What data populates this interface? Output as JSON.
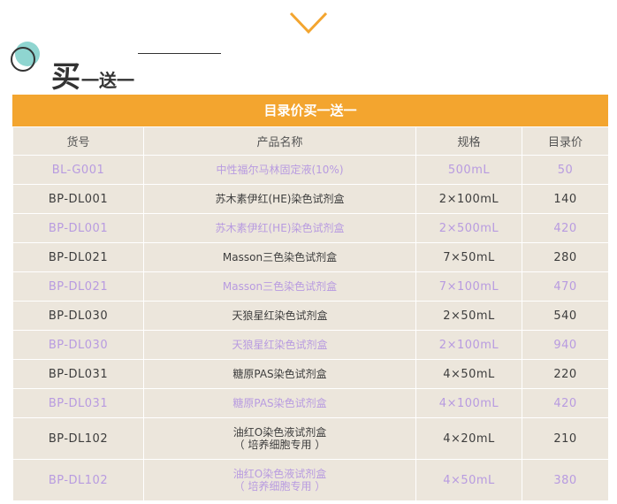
{
  "header": {
    "title_main": "买",
    "title_sub": "一送一"
  },
  "colors": {
    "accent_orange": "#f3a52f",
    "circle_teal": "#8fd5d0",
    "table_bg": "#ece6dc",
    "light_text": "#b89be0",
    "dark_text": "#3d3d3d"
  },
  "table": {
    "banner": "目录价买一送一",
    "columns": [
      "货号",
      "产品名称",
      "规格",
      "目录价"
    ],
    "rows": [
      {
        "code": "BL-G001",
        "name": "中性福尔马林固定液(10%)",
        "name2": "",
        "spec": "500mL",
        "price": "50"
      },
      {
        "code": "BP-DL001",
        "name": "苏木素伊红(HE)染色试剂盒",
        "name2": "",
        "spec": "2×100mL",
        "price": "140"
      },
      {
        "code": "BP-DL001",
        "name": "苏木素伊红(HE)染色试剂盒",
        "name2": "",
        "spec": "2×500mL",
        "price": "420"
      },
      {
        "code": "BP-DL021",
        "name": "Masson三色染色试剂盒",
        "name2": "",
        "spec": "7×50mL",
        "price": "280"
      },
      {
        "code": "BP-DL021",
        "name": "Masson三色染色试剂盒",
        "name2": "",
        "spec": "7×100mL",
        "price": "470"
      },
      {
        "code": "BP-DL030",
        "name": "天狼星红染色试剂盒",
        "name2": "",
        "spec": "2×50mL",
        "price": "540"
      },
      {
        "code": "BP-DL030",
        "name": "天狼星红染色试剂盒",
        "name2": "",
        "spec": "2×100mL",
        "price": "940"
      },
      {
        "code": "BP-DL031",
        "name": "糖原PAS染色试剂盒",
        "name2": "",
        "spec": "4×50mL",
        "price": "220"
      },
      {
        "code": "BP-DL031",
        "name": "糖原PAS染色试剂盒",
        "name2": "",
        "spec": "4×100mL",
        "price": "420"
      },
      {
        "code": "BP-DL102",
        "name": "油红O染色液试剂盒",
        "name2": "（ 培养细胞专用 ）",
        "spec": "4×20mL",
        "price": "210"
      },
      {
        "code": "BP-DL102",
        "name": "油红O染色液试剂盒",
        "name2": "（ 培养细胞专用 ）",
        "spec": "4×50mL",
        "price": "380"
      }
    ]
  }
}
